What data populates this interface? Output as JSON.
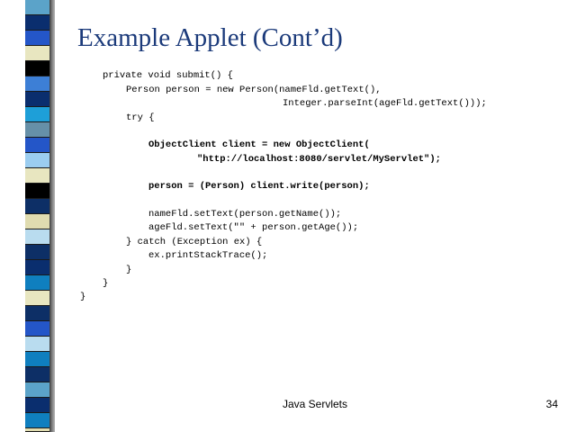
{
  "slide": {
    "title": "Example Applet (Cont’d)",
    "footer": "Java Servlets",
    "page_number": "34"
  },
  "code_lines": [
    {
      "text": "private void submit() {",
      "bold": false
    },
    {
      "text": "Person person = new Person(nameFld.getText(),",
      "bold": false
    },
    {
      "text": "Integer.parseInt(ageFld.getText()));",
      "bold": false
    },
    {
      "text": "try {",
      "bold": false
    },
    {
      "text": "ObjectClient client = new ObjectClient(",
      "bold": true
    },
    {
      "text": "\"http://localhost:8080/servlet/MyServlet\");",
      "bold": true
    },
    {
      "text": "person = (Person) client.write(person);",
      "bold": true
    },
    {
      "text": "nameFld.setText(person.getName());",
      "bold": false
    },
    {
      "text": "ageFld.setText(\"\" + person.getAge());",
      "bold": false
    },
    {
      "text": "} catch (Exception ex) {",
      "bold": false
    },
    {
      "text": "ex.printStackTrace();",
      "bold": false
    },
    {
      "text": "}",
      "bold": false
    },
    {
      "text": "}",
      "bold": false
    },
    {
      "text": "}",
      "bold": false
    }
  ],
  "colors": {
    "title": "#1b3a7a",
    "strip": [
      "#5ba3c9",
      "#0a2e6e",
      "#2456c8",
      "#e8e6c0",
      "#000000",
      "#3d7fd6",
      "#1e9fd8",
      "#9bcdf0",
      "#b9dcef",
      "#0f7fbf",
      "#e0dcb0",
      "#6690a8",
      "#0d2f66"
    ]
  }
}
